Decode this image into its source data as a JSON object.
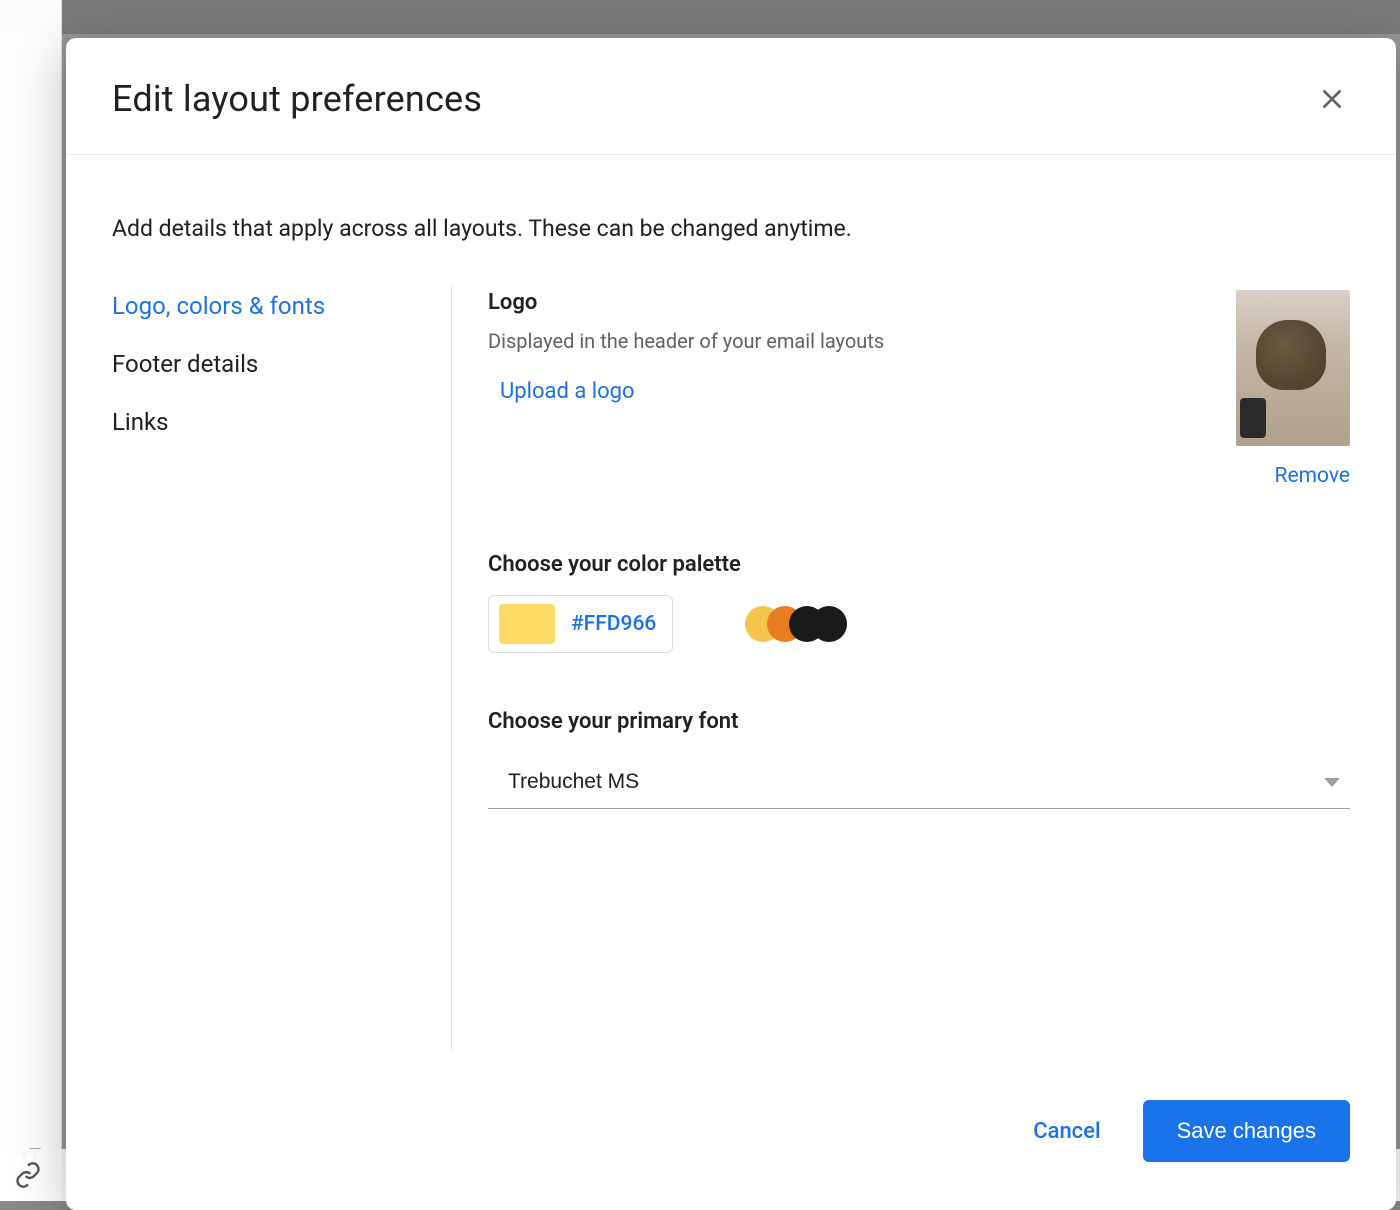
{
  "modal": {
    "title": "Edit layout preferences",
    "intro": "Add details that apply across all layouts. These can be changed anytime."
  },
  "nav": {
    "items": [
      {
        "label": "Logo, colors & fonts",
        "active": true
      },
      {
        "label": "Footer details",
        "active": false
      },
      {
        "label": "Links",
        "active": false
      }
    ]
  },
  "logo": {
    "heading": "Logo",
    "desc": "Displayed in the header of your email layouts",
    "upload_label": "Upload a logo",
    "remove_label": "Remove"
  },
  "palette": {
    "heading": "Choose your color palette",
    "primary_hex": "#FFD966",
    "swatches": [
      "#F4C54A",
      "#E87C1E",
      "#1A1A1A",
      "#1A1A1A"
    ]
  },
  "font": {
    "heading": "Choose your primary font",
    "selected": "Trebuchet MS"
  },
  "footer": {
    "cancel": "Cancel",
    "save": "Save changes"
  },
  "left_toolbar": {
    "text_tool": "тT"
  }
}
